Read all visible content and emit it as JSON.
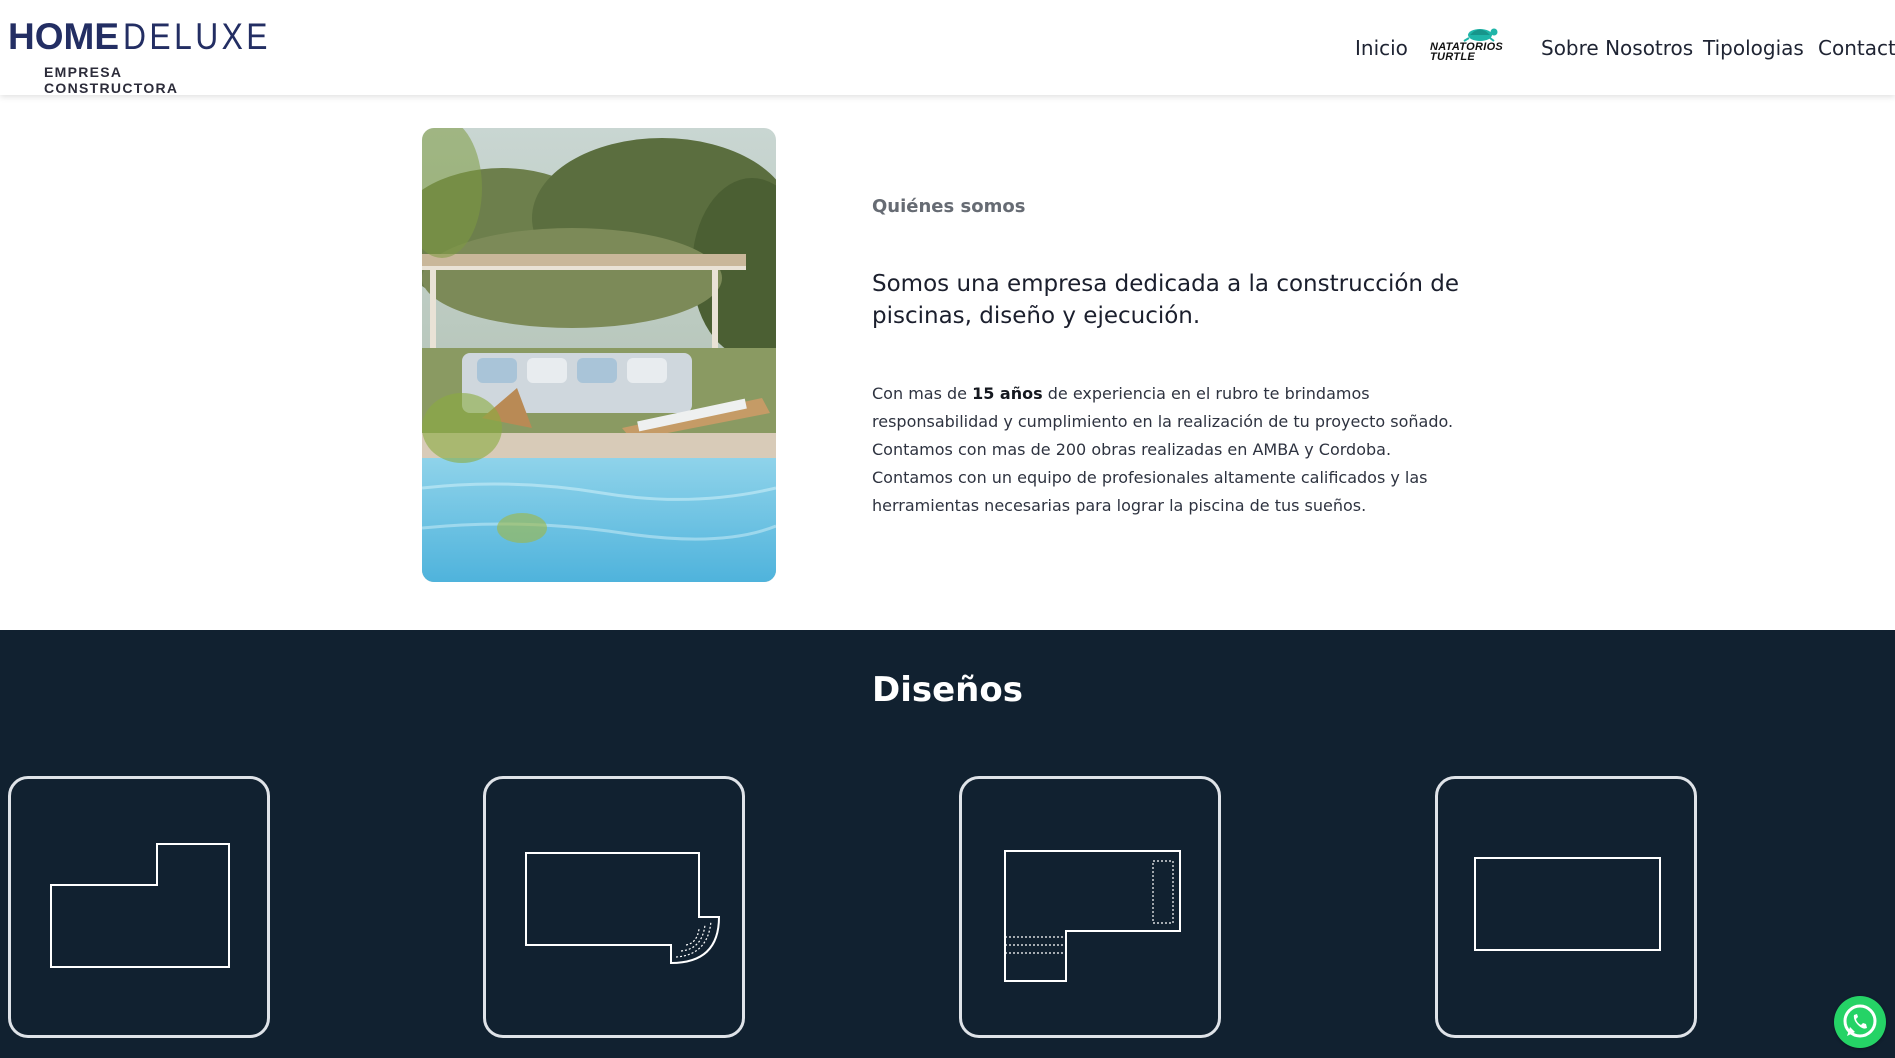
{
  "brand": {
    "name_bold": "HOME",
    "name_light": "DELUXE",
    "tagline": "EMPRESA CONSTRUCTORA",
    "color": "#232e63"
  },
  "nav": {
    "items": [
      {
        "label": "Inicio"
      },
      {
        "label": "Sobre Nosotros"
      },
      {
        "label": "Tipologias"
      },
      {
        "label": "Contacto"
      }
    ],
    "partner_logo": {
      "line1": "NATATORIOS",
      "line2": "TURTLE",
      "icon": "turtle-icon",
      "icon_color": "#1fb5a8"
    }
  },
  "about": {
    "image": "pool-with-pergola-photo",
    "eyebrow": "Quiénes somos",
    "heading": "Somos una empresa dedicada a la construcción de piscinas, diseño y ejecución.",
    "body_pre": "Con mas de ",
    "body_bold": "15 años",
    "body_post": " de experiencia en el rubro te brindamos responsabilidad y cumplimiento en la realización de tu proyecto soñado. Contamos con mas de 200 obras realizadas en AMBA y Cordoba. Contamos con un equipo de profesionales altamente calificados y las herramientas necesarias para lograr la piscina de tus sueños."
  },
  "designs": {
    "title": "Diseños",
    "background": "#112130",
    "cards": [
      {
        "icon": "l-shape-pool-icon"
      },
      {
        "icon": "rectangle-pool-with-rounded-steps-icon"
      },
      {
        "icon": "l-shape-pool-with-bench-icon"
      },
      {
        "icon": "rectangle-pool-icon"
      }
    ]
  },
  "whatsapp": {
    "icon": "whatsapp-icon",
    "color": "#25d366"
  }
}
